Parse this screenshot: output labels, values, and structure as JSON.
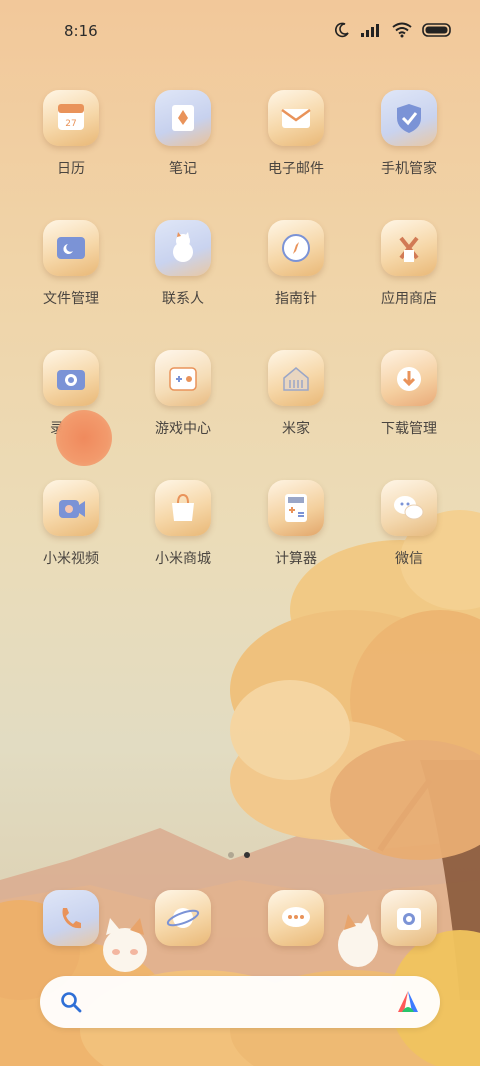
{
  "status_bar": {
    "time": "8:16"
  },
  "apps": [
    {
      "label": "日历"
    },
    {
      "label": "笔记"
    },
    {
      "label": "电子邮件"
    },
    {
      "label": "手机管家"
    },
    {
      "label": "文件管理"
    },
    {
      "label": "联系人"
    },
    {
      "label": "指南针"
    },
    {
      "label": "应用商店"
    },
    {
      "label": "录音机"
    },
    {
      "label": "游戏中心"
    },
    {
      "label": "米家"
    },
    {
      "label": "下载管理"
    },
    {
      "label": "小米视频"
    },
    {
      "label": "小米商城"
    },
    {
      "label": "计算器"
    },
    {
      "label": "微信"
    }
  ],
  "calendar_icon_day": "27",
  "page_indicator": {
    "pages": 2,
    "active": 2
  },
  "dock": [
    "phone-icon",
    "browser-icon",
    "messages-icon",
    "camera-icon"
  ],
  "colors": {
    "accent_blue": "#7b93d6",
    "accent_orange": "#e9935a"
  }
}
